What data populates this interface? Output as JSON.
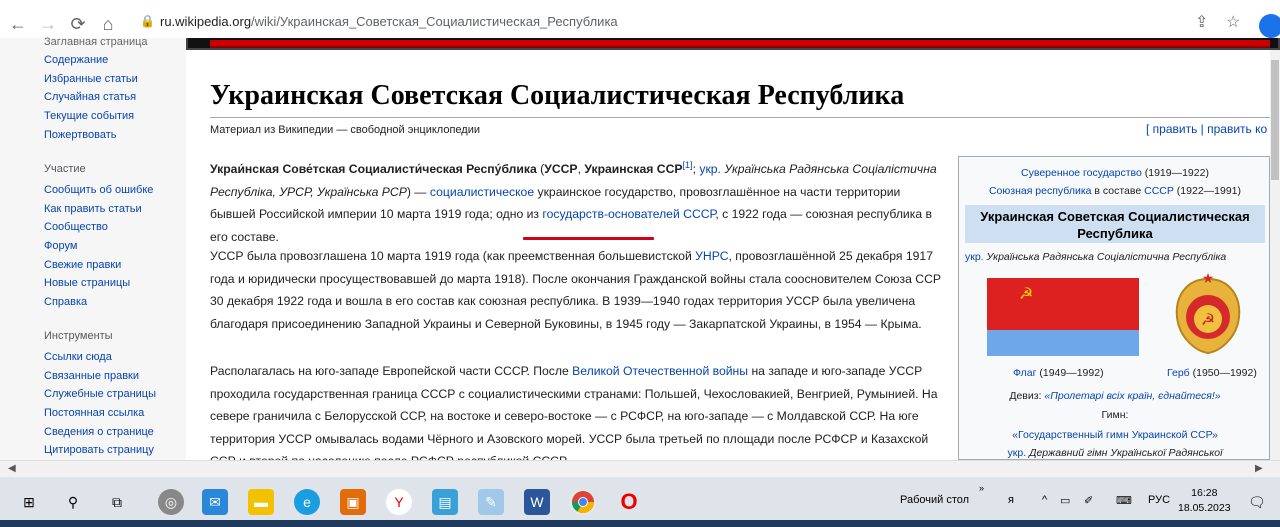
{
  "browser": {
    "url_host": "ru.wikipedia.org",
    "url_path": "/wiki/Украинская_Советская_Социалистическая_Республика"
  },
  "sidebar": {
    "top_items": [
      "Заглавная страница",
      "Содержание",
      "Избранные статьи",
      "Случайная статья",
      "Текущие события",
      "Пожертвовать"
    ],
    "participation_head": "Участие",
    "participation_items": [
      "Сообщить об ошибке",
      "Как править статьи",
      "Сообщество",
      "Форум",
      "Свежие правки",
      "Новые страницы",
      "Справка"
    ],
    "tools_head": "Инструменты",
    "tools_items": [
      "Ссылки сюда",
      "Связанные правки",
      "Служебные страницы",
      "Постоянная ссылка",
      "Сведения о странице",
      "Цитировать страницу"
    ]
  },
  "article": {
    "title": "Украинская Советская Социалистическая Республика",
    "tagline": "Материал из Википедии — свободной энциклопедии",
    "edit_links": "[ править | править ко",
    "p1": {
      "bold1": "Украи́нская Сове́тская Социалисти́ческая Респу́блика",
      "t1": " (",
      "bold2": "УССР",
      "t2": ", ",
      "bold3": "Украинская ССР",
      "sup": "[1]",
      "t3": "; ",
      "ukr_link": "укр.",
      "ital": " Українська Радянська Соціалістична Республіка, УРСР, Українська РСР",
      "t4": ") — ",
      "link1": "социалистическое",
      "t5": " украинское государство, провозглашённое на части территории бывшей Российской империи ",
      "underlined": "10 марта 1919 года",
      "t6": "; одно из ",
      "link2": "государств-основателей СССР",
      "t7": ", с 1922 года — союзная республика в его составе."
    },
    "p2": {
      "t1": "УССР была провозглашена 10 марта 1919 года (как преемственная большевистской ",
      "link": "УНРС",
      "t2": ", провозглашённой 25 декабря 1917 года и юридически просуществовавшей до марта 1918). После окончания Гражданской войны стала соосновителем Союза ССР 30 декабря 1922 года и вошла в его состав как союзная республика. В 1939—1940 годах территория УССР была увеличена благодаря присоединению Западной Украины и Северной Буковины, в 1945 году — Закарпатской Украины, в 1954 — Крыма."
    },
    "p3": {
      "t1": "Располагалась на юго-западе Европейской части СССР. После ",
      "link": "Великой Отечественной войны",
      "t2": " на западе и юго-западе УССР проходила государственная граница СССР с социалистическими странами: Польшей, Чехословакией, Венгрией, Румынией. На севере граничила с Белорусской ССР, на востоке и северо-востоке — с РСФСР, на юго-западе — с Молдавской ССР. На юге территория УССР омывалась водами Чёрного и Азовского морей. УССР была третьей по площади после РСФСР и Казахской ССР и второй по населению после РСФСР республикой СССР."
    }
  },
  "infobox": {
    "line1_link": "Суверенное государство",
    "line1_dates": " (1919—1922)",
    "line2_link": "Союзная республика",
    "line2_mid": " в составе ",
    "line2_link2": "СССР",
    "line2_dates": " (1922—1991)",
    "title": "Украинская Советская Социалистическая Республика",
    "ukr_label": "укр.",
    "ukr_name": " Українська Радянська Соціалістична Республіка",
    "flag_link": "Флаг",
    "flag_dates": " (1949—1992)",
    "coat_link": "Герб",
    "coat_dates": " (1950—1992)",
    "motto_link": "Девиз:",
    "motto": " «Пролетарі всіх країн, єднайтеся!»",
    "anthem_label": "Гимн:",
    "anthem": "«Государственный гимн Украинской ССР»",
    "anthem2_label": "укр.",
    "anthem2": " Державний гімн Української Радянської"
  },
  "taskbar": {
    "desktop_label": "Рабочий стол",
    "lang": "РУС",
    "time": "16:28",
    "date": "18.05.2023"
  },
  "colors": {
    "link": "#0645ad",
    "infobox_header": "#cedff2",
    "flag_red": "#dd2020",
    "flag_blue": "#6fa8e8",
    "annotation_red": "#d0021b"
  }
}
